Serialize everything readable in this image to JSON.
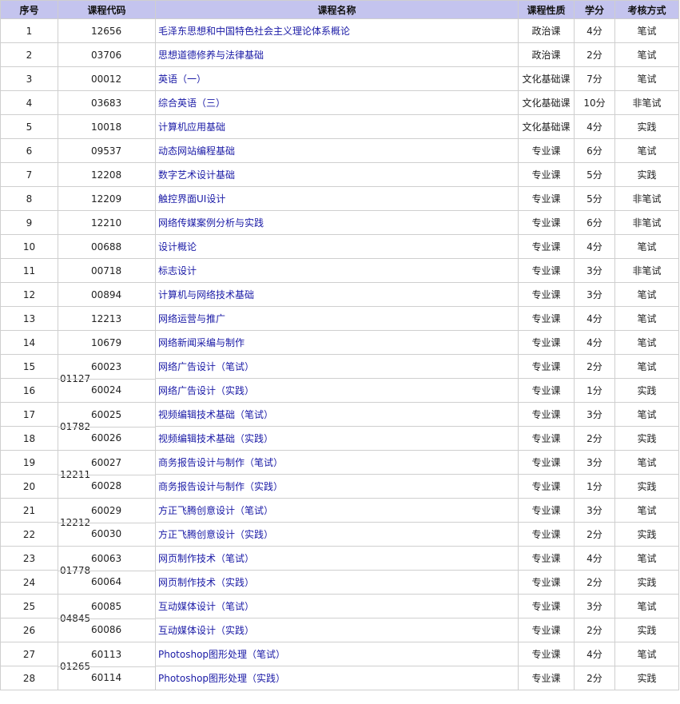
{
  "table": {
    "headers": [
      "序号",
      "课程代码",
      "课程名称",
      "课程性质",
      "学分",
      "考核方式"
    ],
    "rows": [
      {
        "no": "1",
        "code": "12656",
        "name": "毛泽东思想和中国特色社会主义理论体系概论",
        "type": "政治课",
        "credit": "4分",
        "exam": "笔试"
      },
      {
        "no": "2",
        "code": "03706",
        "name": "思想道德修养与法律基础",
        "type": "政治课",
        "credit": "2分",
        "exam": "笔试"
      },
      {
        "no": "3",
        "code": "00012",
        "name": "英语（一）",
        "type": "文化基础课",
        "credit": "7分",
        "exam": "笔试"
      },
      {
        "no": "4",
        "code": "03683",
        "name": "综合英语（三）",
        "type": "文化基础课",
        "credit": "10分",
        "exam": "非笔试"
      },
      {
        "no": "5",
        "code": "10018",
        "name": "计算机应用基础",
        "type": "文化基础课",
        "credit": "4分",
        "exam": "实践"
      },
      {
        "no": "6",
        "code": "09537",
        "name": "动态网站编程基础",
        "type": "专业课",
        "credit": "6分",
        "exam": "笔试"
      },
      {
        "no": "7",
        "code": "12208",
        "name": "数字艺术设计基础",
        "type": "专业课",
        "credit": "5分",
        "exam": "实践"
      },
      {
        "no": "8",
        "code": "12209",
        "name": "触控界面UI设计",
        "type": "专业课",
        "credit": "5分",
        "exam": "非笔试"
      },
      {
        "no": "9",
        "code": "12210",
        "name": "网络传媒案例分析与实践",
        "type": "专业课",
        "credit": "6分",
        "exam": "非笔试"
      },
      {
        "no": "10",
        "code": "00688",
        "name": "设计概论",
        "type": "专业课",
        "credit": "4分",
        "exam": "笔试"
      },
      {
        "no": "11",
        "code": "00718",
        "name": "标志设计",
        "type": "专业课",
        "credit": "3分",
        "exam": "非笔试"
      },
      {
        "no": "12",
        "code": "00894",
        "name": "计算机与网络技术基础",
        "type": "专业课",
        "credit": "3分",
        "exam": "笔试"
      },
      {
        "no": "13",
        "code": "12213",
        "name": "网络运营与推广",
        "type": "专业课",
        "credit": "4分",
        "exam": "笔试"
      },
      {
        "no": "14",
        "code": "10679",
        "name": "网络新闻采编与制作",
        "type": "专业课",
        "credit": "4分",
        "exam": "笔试"
      }
    ],
    "groups": [
      {
        "parent": "01127",
        "rows": [
          {
            "no": "15",
            "code": "60023",
            "name": "网络广告设计（笔试）",
            "type": "专业课",
            "credit": "2分",
            "exam": "笔试"
          },
          {
            "no": "16",
            "code": "60024",
            "name": "网络广告设计（实践）",
            "type": "专业课",
            "credit": "1分",
            "exam": "实践"
          }
        ]
      },
      {
        "parent": "01782",
        "rows": [
          {
            "no": "17",
            "code": "60025",
            "name": "视频编辑技术基础（笔试）",
            "type": "专业课",
            "credit": "3分",
            "exam": "笔试"
          },
          {
            "no": "18",
            "code": "60026",
            "name": "视频编辑技术基础（实践）",
            "type": "专业课",
            "credit": "2分",
            "exam": "实践"
          }
        ]
      },
      {
        "parent": "12211",
        "rows": [
          {
            "no": "19",
            "code": "60027",
            "name": "商务报告设计与制作（笔试）",
            "type": "专业课",
            "credit": "3分",
            "exam": "笔试"
          },
          {
            "no": "20",
            "code": "60028",
            "name": "商务报告设计与制作（实践）",
            "type": "专业课",
            "credit": "1分",
            "exam": "实践"
          }
        ]
      },
      {
        "parent": "12212",
        "rows": [
          {
            "no": "21",
            "code": "60029",
            "name": "方正飞腾创意设计（笔试）",
            "type": "专业课",
            "credit": "3分",
            "exam": "笔试"
          },
          {
            "no": "22",
            "code": "60030",
            "name": "方正飞腾创意设计（实践）",
            "type": "专业课",
            "credit": "2分",
            "exam": "实践"
          }
        ]
      },
      {
        "parent": "01778",
        "rows": [
          {
            "no": "23",
            "code": "60063",
            "name": "网页制作技术（笔试）",
            "type": "专业课",
            "credit": "4分",
            "exam": "笔试"
          },
          {
            "no": "24",
            "code": "60064",
            "name": "网页制作技术（实践）",
            "type": "专业课",
            "credit": "2分",
            "exam": "实践"
          }
        ]
      },
      {
        "parent": "04845",
        "rows": [
          {
            "no": "25",
            "code": "60085",
            "name": "互动媒体设计（笔试）",
            "type": "专业课",
            "credit": "3分",
            "exam": "笔试"
          },
          {
            "no": "26",
            "code": "60086",
            "name": "互动媒体设计（实践）",
            "type": "专业课",
            "credit": "2分",
            "exam": "实践"
          }
        ]
      },
      {
        "parent": "01265",
        "rows": [
          {
            "no": "27",
            "code": "60113",
            "name": "Photoshop图形处理（笔试）",
            "type": "专业课",
            "credit": "4分",
            "exam": "笔试"
          },
          {
            "no": "28",
            "code": "60114",
            "name": "Photoshop图形处理（实践）",
            "type": "专业课",
            "credit": "2分",
            "exam": "实践"
          }
        ]
      }
    ]
  }
}
